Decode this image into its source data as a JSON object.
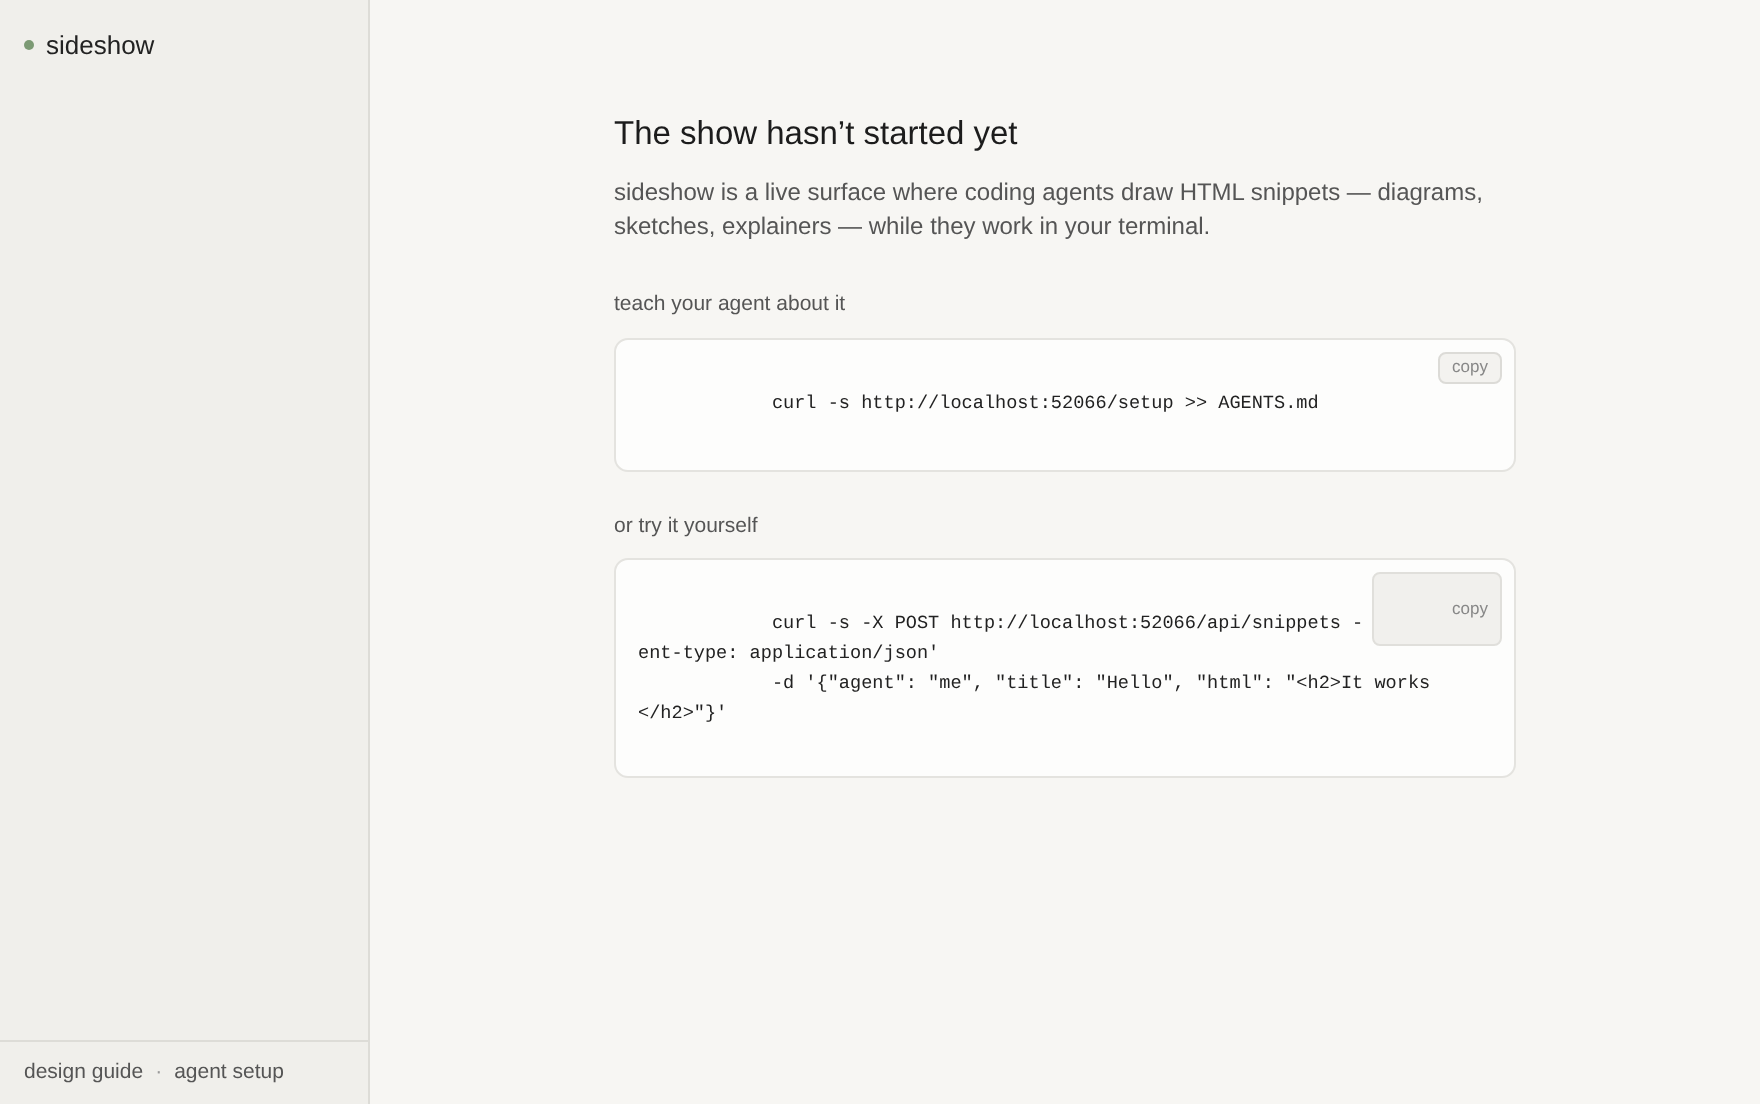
{
  "sidebar": {
    "brand": "sideshow",
    "footer_links": [
      "design guide",
      "agent setup"
    ],
    "separator": "·"
  },
  "main": {
    "title": "The show hasn’t started yet",
    "description": "sideshow is a live surface where coding agents draw HTML snippets — diagrams, sketches, explainers — while they work in your terminal.",
    "sections": [
      {
        "kind": "inline",
        "label": "teach your agent about it",
        "copy_button": "copy",
        "code_lines": [
          "            curl -s http://localhost:52066/setup >> AGENTS.md"
        ]
      },
      {
        "kind": "overlay",
        "label": "or try it yourself",
        "copy_button": "copy",
        "code_lines": [
          "            curl -s -X POST http://localhost:52066/api/snippets -",
          "ent-type: application/json'",
          "            -d '{\"agent\": \"me\", \"title\": \"Hello\", \"html\": \"<h2>It works",
          "</h2>\"}'"
        ]
      }
    ]
  }
}
